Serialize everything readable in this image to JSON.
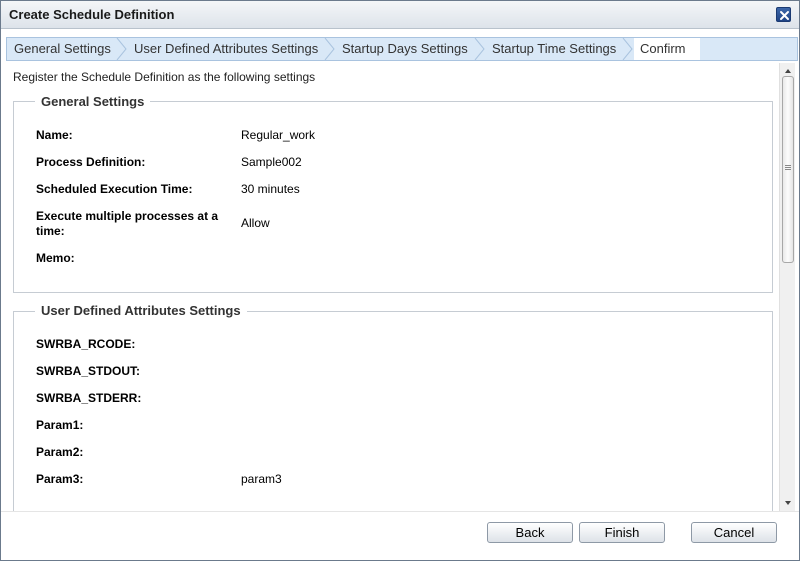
{
  "window": {
    "title": "Create Schedule Definition",
    "close_icon": "close-icon"
  },
  "tabs": [
    {
      "label": "General Settings",
      "active": false
    },
    {
      "label": "User Defined Attributes Settings",
      "active": false
    },
    {
      "label": "Startup Days Settings",
      "active": false
    },
    {
      "label": "Startup Time Settings",
      "active": false
    },
    {
      "label": "Confirm",
      "active": true
    }
  ],
  "intro": "Register the Schedule Definition as the following settings",
  "general": {
    "legend": "General Settings",
    "rows": [
      {
        "label": "Name:",
        "value": "Regular_work"
      },
      {
        "label": "Process Definition:",
        "value": "Sample002"
      },
      {
        "label": "Scheduled Execution Time:",
        "value": "30 minutes"
      },
      {
        "label": "Execute multiple processes at a time:",
        "value": "Allow"
      },
      {
        "label": "Memo:",
        "value": ""
      }
    ]
  },
  "user_defined": {
    "legend": "User Defined Attributes Settings",
    "rows": [
      {
        "label": "SWRBA_RCODE:",
        "value": ""
      },
      {
        "label": "SWRBA_STDOUT:",
        "value": ""
      },
      {
        "label": "SWRBA_STDERR:",
        "value": ""
      },
      {
        "label": "Param1:",
        "value": ""
      },
      {
        "label": "Param2:",
        "value": ""
      },
      {
        "label": "Param3:",
        "value": "param3"
      }
    ]
  },
  "buttons": {
    "back": "Back",
    "finish": "Finish",
    "cancel": "Cancel"
  },
  "colors": {
    "tab_bar": "#d9e8f7",
    "title_bg": "#dde3ea",
    "close_bg": "#1f4486"
  }
}
